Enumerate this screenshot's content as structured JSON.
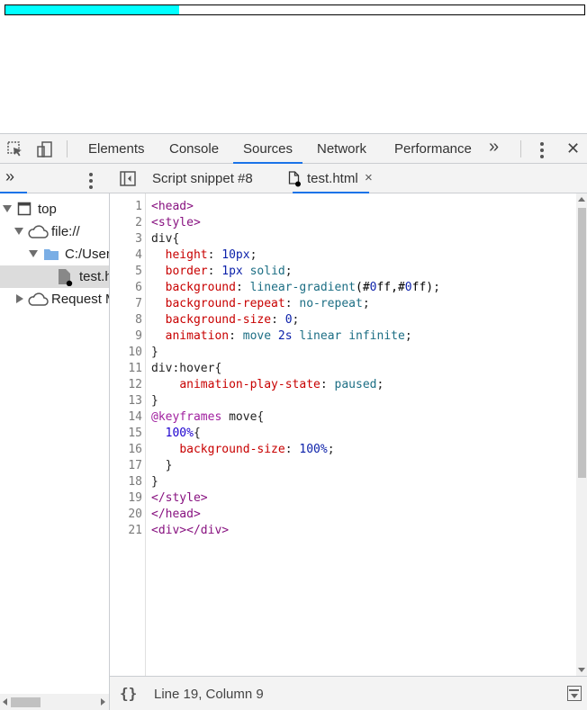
{
  "page": {
    "progress_percent": 30
  },
  "toolbar": {
    "tabs": [
      {
        "label": "Elements"
      },
      {
        "label": "Console"
      },
      {
        "label": "Sources"
      },
      {
        "label": "Network"
      },
      {
        "label": "Performance"
      }
    ],
    "active_tab": "Sources",
    "more_tabs_label": "»",
    "close_label": "✕"
  },
  "navigator": {
    "more_label": "»",
    "tree": [
      {
        "label": "top",
        "icon": "frame-icon",
        "expanded": true
      },
      {
        "label": "file://",
        "icon": "cloud-icon",
        "expanded": true
      },
      {
        "label": "C:/Users",
        "icon": "folder-icon",
        "expanded": true
      },
      {
        "label": "test.html",
        "icon": "file-icon",
        "selected": true
      },
      {
        "label": "Request Mocks",
        "icon": "cloud-icon",
        "expanded": false
      }
    ]
  },
  "editor": {
    "tabs": [
      {
        "label": "Script snippet #8"
      },
      {
        "label": "test.html",
        "close": "×"
      }
    ],
    "active_tab": "test.html",
    "code_lines": [
      "<head>",
      "<style>",
      "div{",
      "  height: 10px;",
      "  border: 1px solid;",
      "  background: linear-gradient(#0ff,#0ff);",
      "  background-repeat: no-repeat;",
      "  background-size: 0;",
      "  animation: move 2s linear infinite;",
      "}",
      "div:hover{",
      "    animation-play-state: paused;",
      "}",
      "@keyframes move{",
      "  100%{",
      "    background-size: 100%;",
      "  }",
      "}",
      "</style>",
      "</head>",
      "<div></div>"
    ]
  },
  "status": {
    "format_label": "{}",
    "cursor_position": "Line 19, Column 9"
  }
}
